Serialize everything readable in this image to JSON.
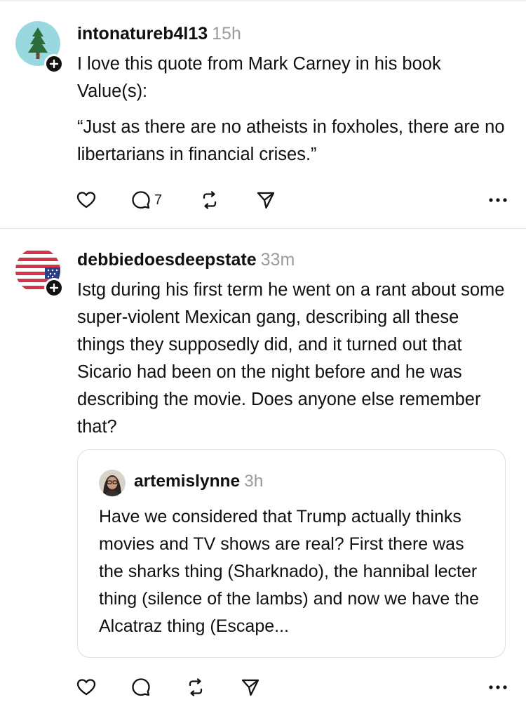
{
  "posts": [
    {
      "username": "intonatureb4l13",
      "time": "15h",
      "paragraphs": [
        "I love this quote from Mark Carney in his book Value(s):",
        "“Just as there are no atheists in foxholes, there are no libertarians in financial crises.”"
      ],
      "reply_count": "7",
      "avatar_icon": "pine-tree-icon"
    },
    {
      "username": "debbiedoesdeepstate",
      "time": "33m",
      "text": "Istg during his first term he went on a rant about some super-violent Mexican gang, describing all these things they supposedly did, and it turned out that Sicario had been on the night before and he was describing the movie. Does anyone else remember that?",
      "avatar_icon": "us-flag-icon",
      "quoted": {
        "username": "artemislynne",
        "time": "3h",
        "text": "Have we considered that Trump actually thinks movies and TV shows are real? First there was the sharks thing (Sharknado), the hannibal lecter thing (silence of the lambs) and now we have the Alcatraz thing (Escape..."
      }
    }
  ],
  "icons": [
    "heart-icon",
    "comment-icon",
    "repost-icon",
    "share-icon",
    "more-icon",
    "follow-plus-icon"
  ],
  "colors": {
    "text": "#101010",
    "muted": "#9a9a9a",
    "divider": "#e6e6e6",
    "flag_red": "#d1374a",
    "flag_blue": "#2b3f86",
    "tree_bg": "#9ad8e0",
    "tree_green": "#2e6b3a"
  }
}
